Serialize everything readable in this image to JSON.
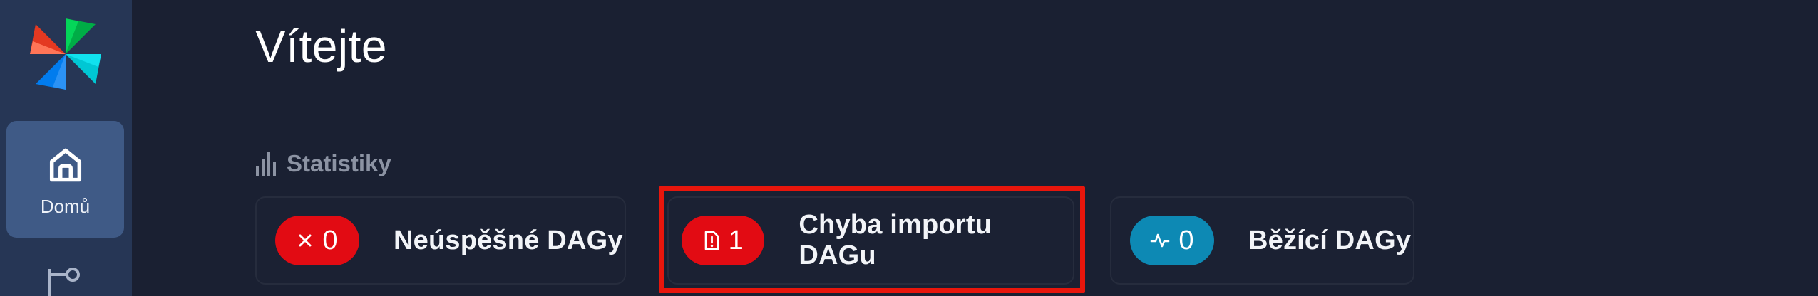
{
  "sidebar": {
    "logo_icon": "airflow-pinwheel-logo",
    "items": [
      {
        "label": "Domů",
        "icon": "home-icon",
        "active": true
      },
      {
        "label": "",
        "icon": "dag-tree-icon",
        "active": false
      }
    ]
  },
  "main": {
    "title": "Vítejte",
    "stats": {
      "heading": "Statistiky",
      "heading_icon": "bar-chart-icon",
      "cards": [
        {
          "count": "0",
          "label": "Neúspěšné DAGy",
          "icon": "close-icon",
          "color": "#e20b13"
        },
        {
          "count": "1",
          "label": "Chyba importu DAGu",
          "icon": "file-warning-icon",
          "color": "#e20b13",
          "highlighted": true
        },
        {
          "count": "0",
          "label": "Běžící DAGy",
          "icon": "activity-icon",
          "color": "#0d89b4"
        }
      ]
    }
  },
  "colors": {
    "background": "#1a2032",
    "sidebar": "#263655",
    "sidebar_active": "#3f5a86",
    "highlight_border": "#e8160c"
  }
}
